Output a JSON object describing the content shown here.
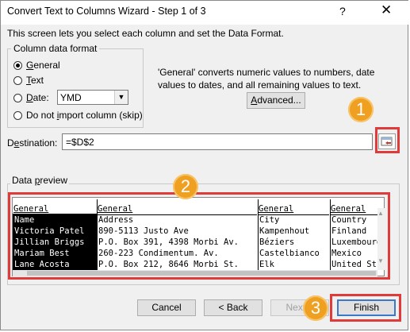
{
  "window": {
    "title": "Convert Text to Columns Wizard - Step 1 of 3",
    "help_glyph": "?",
    "close_glyph": "✕"
  },
  "intro_text": "This screen lets you select each column and set the Data Format.",
  "column_format": {
    "legend": "Column data format",
    "options": [
      {
        "accel": "G",
        "rest": "eneral",
        "checked": true
      },
      {
        "accel": "T",
        "rest": "ext",
        "checked": false
      },
      {
        "accel": "D",
        "rest": "ate:",
        "checked": false
      },
      {
        "pre": "Do not ",
        "accel": "i",
        "rest": "mport column (skip)",
        "checked": false
      }
    ],
    "date_value": "YMD"
  },
  "description": "'General' converts numeric values to numbers, date values to dates, and all remaining values to text.",
  "advanced_button": {
    "accel": "A",
    "rest": "dvanced..."
  },
  "destination": {
    "accel": "e",
    "pre": "D",
    "rest": "stination:",
    "value": "=$D$2"
  },
  "preview": {
    "legend_pre": "Data ",
    "legend_accel": "p",
    "legend_rest": "review",
    "columns": [
      {
        "header": "General",
        "cells": [
          "Name",
          "Victoria Patel",
          "Jillian Briggs",
          "Mariam Best",
          "Lane Acosta"
        ]
      },
      {
        "header": "General",
        "cells": [
          "Address",
          "890-5113 Justo Ave",
          "P.O. Box 391, 4398 Morbi Av.",
          "260-223 Condimentum. Av.",
          "P.O. Box 212, 8646 Morbi St."
        ]
      },
      {
        "header": "General",
        "cells": [
          "City",
          "Kampenhout",
          "Béziers",
          "Castelbianco",
          "Elk"
        ]
      },
      {
        "header": "General",
        "cells": [
          "Country",
          "Finland",
          "Luxembourg",
          "Mexico",
          "United St"
        ]
      }
    ]
  },
  "buttons": {
    "cancel": "Cancel",
    "back": "< Back",
    "next": "Next >",
    "finish": "Finish"
  },
  "callouts": [
    "1",
    "2",
    "3"
  ],
  "colors": {
    "callout": "#f0a020",
    "highlight": "#e03b3b"
  },
  "icons": {
    "scroll_up": "▲",
    "scroll_down": "▼",
    "dropdown": "▼"
  }
}
